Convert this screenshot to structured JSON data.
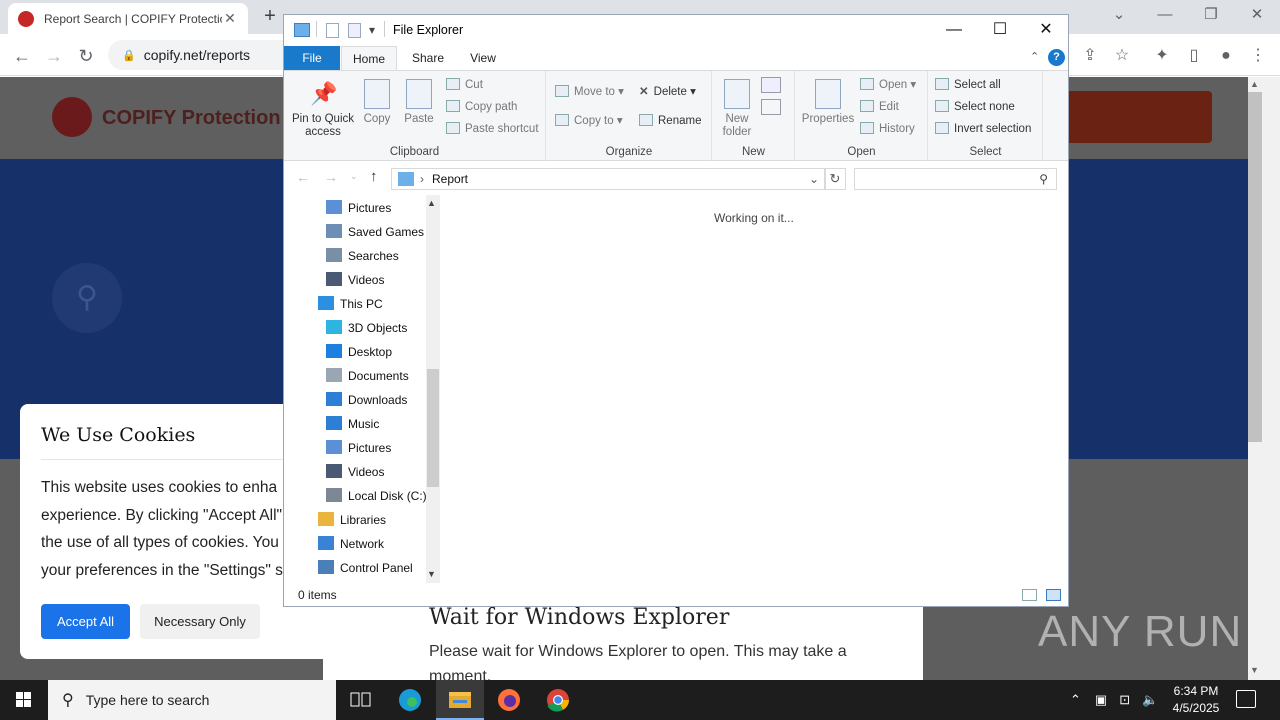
{
  "browser": {
    "tab_title": "Report Search | COPIFY Protectio",
    "url": "copify.net/reports"
  },
  "page": {
    "brand": "COPIFY Protection",
    "watermark": "ANY RUN"
  },
  "cookie": {
    "title": "We Use Cookies",
    "body_lines": [
      "This website uses cookies to enha",
      "experience. By clicking \"Accept All\"",
      "the use of all types of cookies. You",
      "your preferences in the \"Settings\" s"
    ],
    "accept_label": "Accept All",
    "necessary_label": "Necessary Only"
  },
  "wait_card": {
    "title": "Wait for Windows Explorer",
    "body": "Please wait for Windows Explorer to open. This may take a moment."
  },
  "explorer": {
    "title": "File Explorer",
    "tabs": [
      "File",
      "Home",
      "Share",
      "View"
    ],
    "clipboard": {
      "group": "Clipboard",
      "pin": "Pin to Quick access",
      "copy": "Copy",
      "paste": "Paste",
      "cut": "Cut",
      "copy_path": "Copy path",
      "paste_shortcut": "Paste shortcut"
    },
    "organize": {
      "group": "Organize",
      "move_to": "Move to",
      "copy_to": "Copy to",
      "delete": "Delete",
      "rename": "Rename"
    },
    "new": {
      "group": "New",
      "new_folder": "New folder"
    },
    "open": {
      "group": "Open",
      "properties": "Properties",
      "open": "Open",
      "edit": "Edit",
      "history": "History"
    },
    "select": {
      "group": "Select",
      "select_all": "Select all",
      "select_none": "Select none",
      "invert": "Invert selection"
    },
    "address": {
      "crumb": "Report"
    },
    "nav_items": [
      {
        "label": "Pictures",
        "icon": "pictures-icon",
        "indent": 1
      },
      {
        "label": "Saved Games",
        "icon": "saved-games-icon",
        "indent": 1
      },
      {
        "label": "Searches",
        "icon": "searches-icon",
        "indent": 1
      },
      {
        "label": "Videos",
        "icon": "videos-icon",
        "indent": 1
      },
      {
        "label": "This PC",
        "icon": "this-pc-icon",
        "indent": 0
      },
      {
        "label": "3D Objects",
        "icon": "3d-objects-icon",
        "indent": 1
      },
      {
        "label": "Desktop",
        "icon": "desktop-icon",
        "indent": 1
      },
      {
        "label": "Documents",
        "icon": "documents-icon",
        "indent": 1
      },
      {
        "label": "Downloads",
        "icon": "downloads-icon",
        "indent": 1
      },
      {
        "label": "Music",
        "icon": "music-icon",
        "indent": 1
      },
      {
        "label": "Pictures",
        "icon": "pictures-icon",
        "indent": 1
      },
      {
        "label": "Videos",
        "icon": "videos-icon",
        "indent": 1
      },
      {
        "label": "Local Disk (C:)",
        "icon": "local-disk-icon",
        "indent": 1
      },
      {
        "label": "Libraries",
        "icon": "libraries-icon",
        "indent": 0
      },
      {
        "label": "Network",
        "icon": "network-icon",
        "indent": 0
      },
      {
        "label": "Control Panel",
        "icon": "control-panel-icon",
        "indent": 0
      }
    ],
    "working": "Working on it...",
    "status_count": "0 items"
  },
  "taskbar": {
    "search_placeholder": "Type here to search",
    "time": "6:34 PM",
    "date": "4/5/2025"
  }
}
